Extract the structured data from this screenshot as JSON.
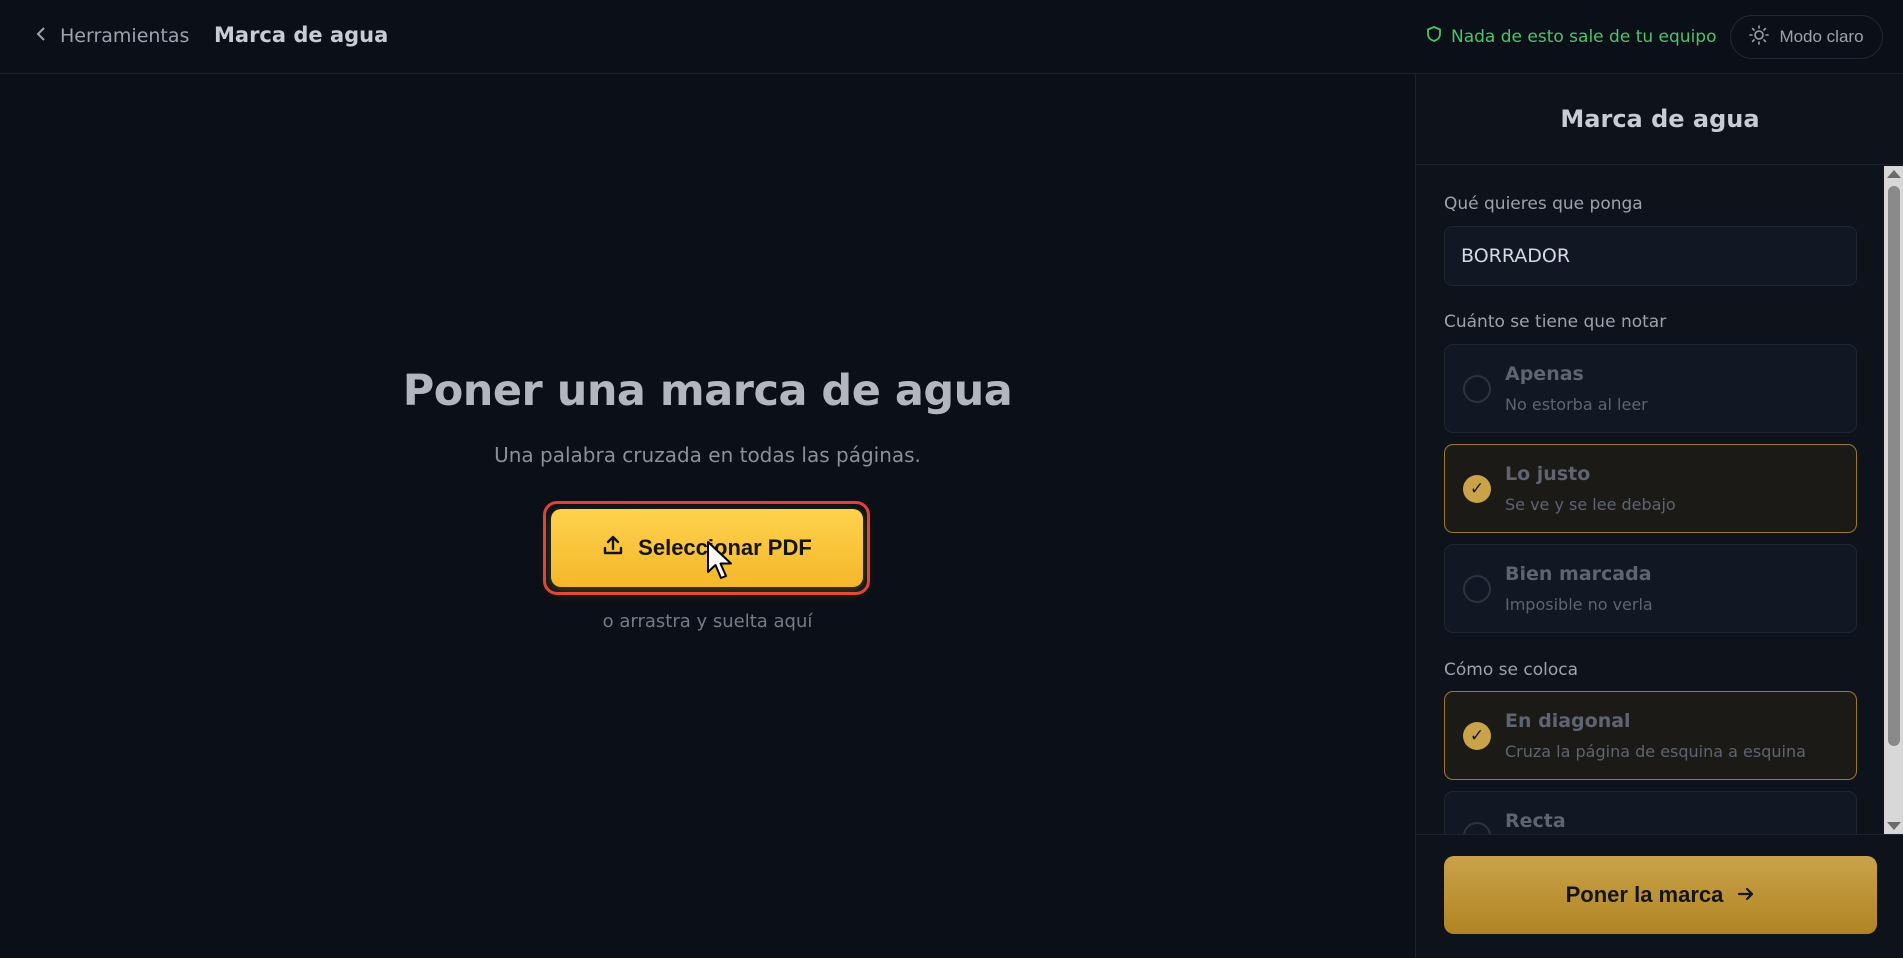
{
  "header": {
    "back_label": "Herramientas",
    "title": "Marca de agua",
    "privacy_text": "Nada de esto sale de tu equipo",
    "mode_label": "Modo claro"
  },
  "main": {
    "title": "Poner una marca de agua",
    "subtitle": "Una palabra cruzada en todas las páginas.",
    "select_button": "Seleccionar PDF",
    "drop_hint": "o arrastra y suelta aquí"
  },
  "panel": {
    "title": "Marca de agua",
    "text_label": "Qué quieres que ponga",
    "text_value": "BORRADOR",
    "intensity_label": "Cuánto se tiene que notar",
    "intensity_options": [
      {
        "title": "Apenas",
        "desc": "No estorba al leer",
        "selected": false
      },
      {
        "title": "Lo justo",
        "desc": "Se ve y se lee debajo",
        "selected": true
      },
      {
        "title": "Bien marcada",
        "desc": "Imposible no verla",
        "selected": false
      }
    ],
    "placement_label": "Cómo se coloca",
    "placement_options": [
      {
        "title": "En diagonal",
        "desc": "Cruza la página de esquina a esquina",
        "selected": true
      },
      {
        "title": "Recta",
        "desc": "",
        "selected": false
      }
    ],
    "apply_button": "Poner la marca"
  },
  "colors": {
    "accent": "#f4b72a",
    "privacy_green": "#4cc46b",
    "highlight_red": "#e0413a"
  }
}
